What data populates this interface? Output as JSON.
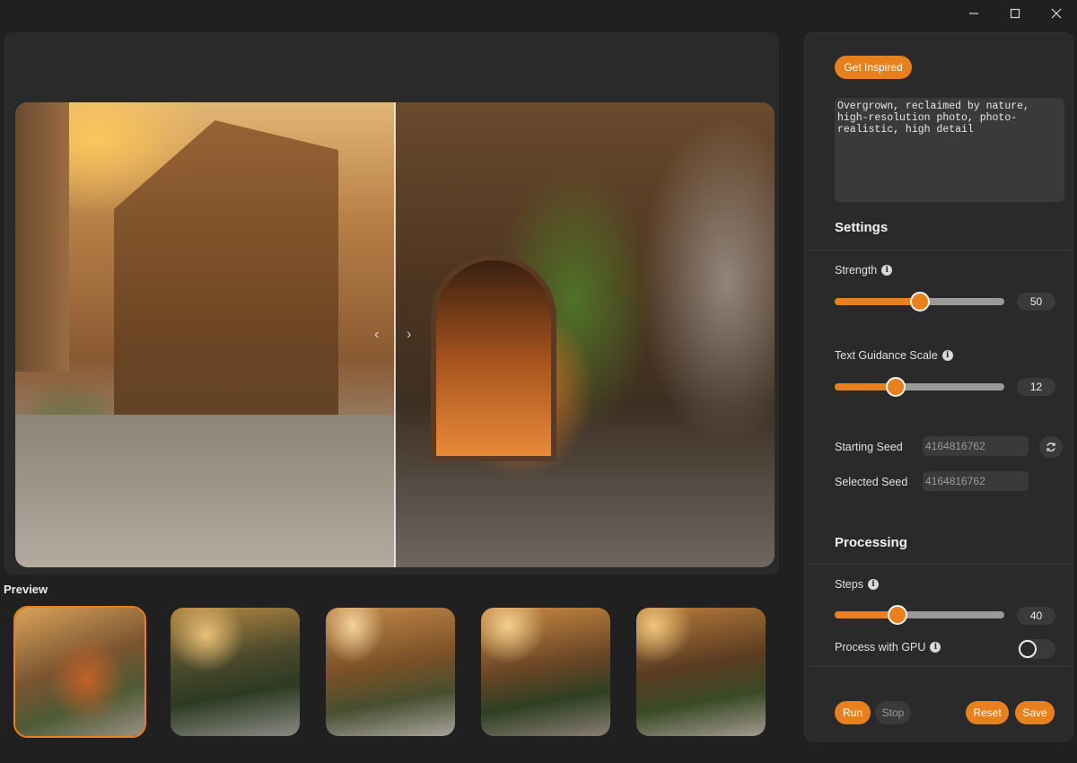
{
  "window": {
    "controls": [
      "minimize",
      "maximize",
      "close"
    ]
  },
  "canvas": {
    "left_nav": "‹",
    "right_nav": "›"
  },
  "preview": {
    "label": "Preview",
    "thumbnails": [
      {
        "selected": true
      },
      {
        "selected": false
      },
      {
        "selected": false
      },
      {
        "selected": false
      },
      {
        "selected": false
      }
    ]
  },
  "sidebar": {
    "inspire_label": "Get Inspired",
    "prompt_text": "Overgrown, reclaimed by nature,\nhigh-resolution photo, photo-\nrealistic, high detail",
    "settings_title": "Settings",
    "strength": {
      "label": "Strength",
      "value": "50",
      "fraction": 0.5
    },
    "guidance": {
      "label": "Text Guidance Scale",
      "value": "12",
      "fraction": 0.36
    },
    "starting_seed": {
      "label": "Starting Seed",
      "value": "4164816762"
    },
    "selected_seed": {
      "label": "Selected Seed",
      "value": "4164816762"
    },
    "processing_title": "Processing",
    "steps": {
      "label": "Steps",
      "value": "40",
      "fraction": 0.37
    },
    "gpu": {
      "label": "Process with GPU",
      "enabled": false
    },
    "buttons": {
      "run": "Run",
      "stop": "Stop",
      "reset": "Reset",
      "save": "Save"
    },
    "accent_color": "#e8801d"
  }
}
